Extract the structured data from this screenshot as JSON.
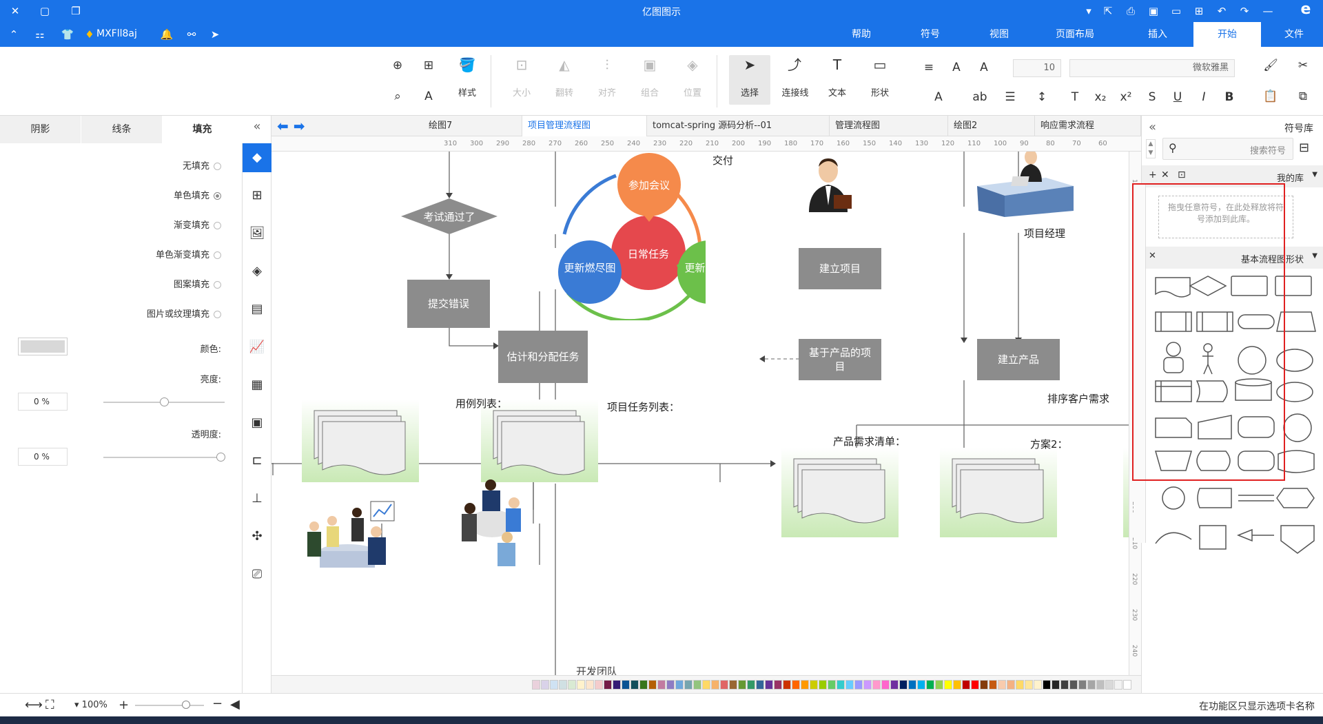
{
  "title_bar": {
    "app_title": "亿图图示"
  },
  "menu": {
    "tabs": [
      "文件",
      "开始",
      "插入",
      "页面布局",
      "视图",
      "符号",
      "帮助"
    ],
    "active_tab": "开始",
    "user_name": "MXFll8aj"
  },
  "ribbon": {
    "font_name": "微软雅黑",
    "font_size": "10",
    "tools": {
      "select": "选择",
      "connector": "连接线",
      "text": "文本",
      "shape": "形状"
    },
    "arrange": {
      "position": "位置",
      "group": "组合",
      "align": "对齐",
      "rotate": "翻转",
      "size": "大小"
    },
    "style": "样式"
  },
  "left_panel": {
    "tabs": [
      "填充",
      "线条",
      "阴影"
    ],
    "fill_options": [
      "无填充",
      "单色填充",
      "渐变填充",
      "单色渐变填充",
      "图案填充",
      "图片或纹理填充"
    ],
    "selected_fill": "单色填充",
    "color_label": "颜色:",
    "brightness_label": "亮度:",
    "brightness_value": "0 %",
    "transparency_label": "透明度:",
    "transparency_value": "0 %"
  },
  "doc_tabs": [
    "响应需求流程",
    "绘图2",
    "管理流程图",
    "tomcat-spring 源码分析--01",
    "项目管理流程图",
    "绘图7"
  ],
  "active_doc_tab": "项目管理流程图",
  "ruler_numbers": [
    "60",
    "70",
    "80",
    "90",
    "100",
    "110",
    "120",
    "130",
    "140",
    "150",
    "160",
    "170",
    "180",
    "190",
    "200",
    "210",
    "220",
    "230",
    "240",
    "250",
    "260",
    "270",
    "280",
    "290",
    "300",
    "310"
  ],
  "vruler_numbers": [
    "110",
    "120",
    "130",
    "140",
    "150",
    "160",
    "170",
    "180",
    "190",
    "200",
    "210",
    "220",
    "230",
    "240"
  ],
  "diagram": {
    "nodes": {
      "test_pass": "考试通过了",
      "submit_error": "提交错误",
      "estimate": "估计和分配任务",
      "meeting": "参加会议",
      "daily_task": "日常任务",
      "update_burndown": "更新燃尽图",
      "update_status": "更新任务状态",
      "create_project": "建立项目",
      "product_project": "基于产品的项目",
      "create_product": "建立产品"
    },
    "labels": {
      "deliver": "交付",
      "use_case_list": "用例列表：",
      "task_list": "项目任务列表：",
      "req_list": "产品需求清单：",
      "plan2": "方案2：",
      "sort_req": "排序客户需求",
      "pm": "项目经理",
      "bottom_cut": "开发团队"
    }
  },
  "right_panel": {
    "title": "符号库",
    "search_placeholder": "搜索符号",
    "my_library": "我的库",
    "drop_hint": "拖曳任意符号，在此处释放将符号添加到此库。",
    "basic_flowchart": "基本流程图形状"
  },
  "status": {
    "hint": "在功能区只显示选项卡名称",
    "zoom": "100%"
  },
  "colors": {
    "accent": "#1a73e8",
    "node_gray": "#8c8c8c",
    "orange": "#f58a4b",
    "red": "#e5484d",
    "blue": "#3a7bd5",
    "green": "#6cc04a",
    "highlight_red": "#e02020",
    "doc_green": "#c9e9b5"
  },
  "palette": [
    "#ffffff",
    "#f2f2f2",
    "#d9d9d9",
    "#bfbfbf",
    "#a6a6a6",
    "#808080",
    "#595959",
    "#404040",
    "#262626",
    "#000000",
    "#fff2cc",
    "#ffe699",
    "#ffd966",
    "#f4b183",
    "#f8cbad",
    "#c55a11",
    "#843c0c",
    "#ff0000",
    "#c00000",
    "#ffc000",
    "#ffff00",
    "#92d050",
    "#00b050",
    "#00b0f0",
    "#0070c0",
    "#002060",
    "#7030a0",
    "#ff66cc",
    "#ff99cc",
    "#cc99ff",
    "#9999ff",
    "#66ccff",
    "#33cccc",
    "#66cc66",
    "#99cc00",
    "#cccc00",
    "#ff9900",
    "#ff6600",
    "#cc3300",
    "#993366",
    "#663399",
    "#336699",
    "#339966",
    "#669933",
    "#996633",
    "#e06666",
    "#f6b26b",
    "#ffd966",
    "#93c47d",
    "#76a5af",
    "#6fa8dc",
    "#8e7cc3",
    "#c27ba0",
    "#b45f06",
    "#38761d",
    "#134f5c",
    "#0b5394",
    "#351c75",
    "#741b47",
    "#f4cccc",
    "#fce5cd",
    "#fff2cc",
    "#d9ead3",
    "#d0e0e3",
    "#cfe2f3",
    "#d9d2e9",
    "#ead1dc"
  ]
}
